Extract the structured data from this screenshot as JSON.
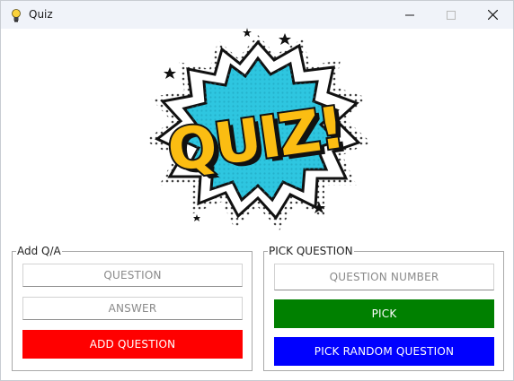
{
  "window": {
    "title": "Quiz",
    "icon": "lightbulb-icon"
  },
  "controls": {
    "minimize_icon": "minimize-icon",
    "maximize_icon": "maximize-icon",
    "close_icon": "close-icon"
  },
  "logo": {
    "text": "QUIZ!",
    "colors": {
      "letters": "#fbbd12",
      "burst_outer": "#ffffff",
      "burst_inner": "#2ec6e0",
      "outline": "#111111"
    }
  },
  "add_group": {
    "label": "Add Q/A",
    "question_placeholder": "QUESTION",
    "answer_placeholder": "ANSWER",
    "add_button": "ADD QUESTION",
    "add_button_color": "#ff0000"
  },
  "pick_group": {
    "label": "PICK QUESTION",
    "number_placeholder": "QUESTION NUMBER",
    "pick_button": "PICK",
    "pick_button_color": "#008000",
    "random_button": "PICK RANDOM QUESTION",
    "random_button_color": "#0000ff"
  }
}
